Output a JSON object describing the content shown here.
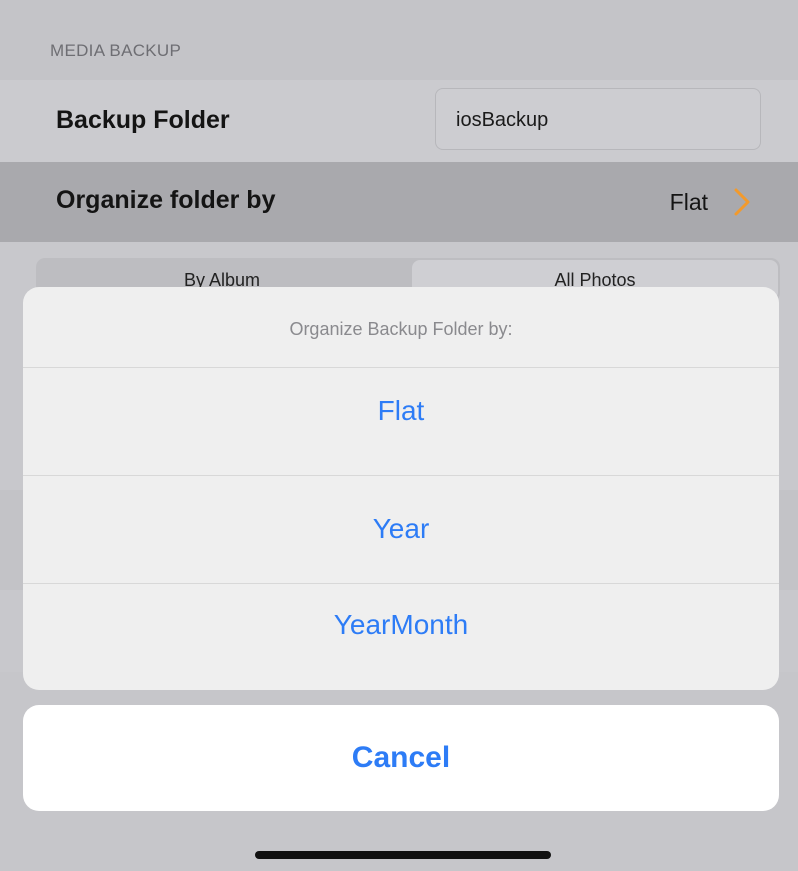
{
  "settings": {
    "section_header": "MEDIA BACKUP",
    "backup_folder": {
      "label": "Backup Folder",
      "value": "iosBackup"
    },
    "organize_folder": {
      "label": "Organize folder by",
      "value": "Flat"
    },
    "segmented_control": {
      "options": [
        "By Album",
        "All Photos"
      ],
      "selected": "All Photos"
    }
  },
  "action_sheet": {
    "title": "Organize Backup Folder by:",
    "options": [
      "Flat",
      "Year",
      "YearMonth"
    ],
    "cancel_label": "Cancel"
  },
  "colors": {
    "accent_blue": "#2d7cf6",
    "chevron_orange": "#f39a2b"
  }
}
